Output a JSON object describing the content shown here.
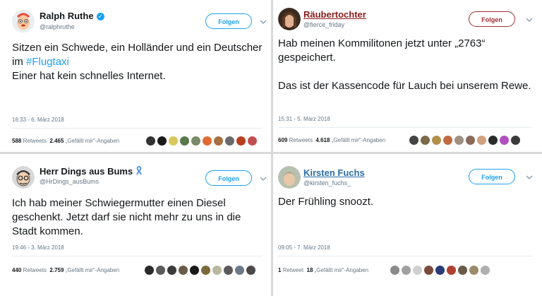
{
  "tweets": [
    {
      "name": "Ralph Ruthe",
      "handle": "@ralphruthe",
      "follow": "Folgen",
      "text_before": "Sitzen ein Schwede, ein Holländer und ein Deutscher im ",
      "hashtag": "#Flugtaxi",
      "text_after": "Einer hat kein schnelles Internet.",
      "time": "16:33 - 6. März 2018",
      "retweets": "588",
      "retweets_label": "Retweets",
      "likes": "2.465",
      "likes_label": "„Gefällt mir“-Angaben",
      "face_colors": [
        "#333333",
        "#1a1a1a",
        "#d8c85a",
        "#5a7a4a",
        "#7a8a6a",
        "#e06a30",
        "#a87040",
        "#6a6a6a",
        "#b84020",
        "#c05050"
      ]
    },
    {
      "name": "Räubertochter",
      "handle": "@fierce_friday",
      "follow": "Folgen",
      "text": "Hab meinen Kommilitonen jetzt unter „2763“ gespeichert.\n\nDas ist der Kassencode für Lauch bei unserem Rewe.",
      "time": "15:31 - 5. März 2018",
      "retweets": "609",
      "retweets_label": "Retweets",
      "likes": "4.618",
      "likes_label": "„Gefällt mir“-Angaben",
      "face_colors": [
        "#444444",
        "#7a6a4a",
        "#b0904a",
        "#c06a40",
        "#a09080",
        "#8a6a5a",
        "#d0a080",
        "#2a2a2a",
        "#b050c0",
        "#3a3a3a"
      ]
    },
    {
      "name": "Herr Dings aus Bums",
      "handle": "@HrDings_ausBums",
      "follow": "Folgen",
      "text": "Ich hab meiner Schwiegermutter einen Diesel geschenkt. Jetzt darf sie nicht mehr zu uns in die Stadt kommen.",
      "time": "19:46 - 3. März 2018",
      "retweets": "440",
      "retweets_label": "Retweets",
      "likes": "2.759",
      "likes_label": "„Gefällt mir“-Angaben",
      "face_colors": [
        "#2a2a2a",
        "#5a5a5a",
        "#3a3a3a",
        "#6a5a4a",
        "#1a1a1a",
        "#7a6a3a",
        "#b8b8a0",
        "#5a5a5a",
        "#6a7a8a",
        "#4a4a4a"
      ]
    },
    {
      "name": "Kirsten Fuchs",
      "handle": "@kirsten_fuchs_",
      "follow": "Folgen",
      "text": "Der Frühling snoozt.",
      "time": "09:05 - 7. März 2018",
      "retweets": "1",
      "retweets_label": "Retweet",
      "likes": "18",
      "likes_label": "„Gefällt mir“-Angaben",
      "face_colors": [
        "#8a8a8a",
        "#a0a0a0",
        "#d0d0d0",
        "#7a4a3a",
        "#2a3a7a",
        "#b04030",
        "#6a5a4a",
        "#9a8a6a",
        "#b0b0b0"
      ]
    }
  ]
}
